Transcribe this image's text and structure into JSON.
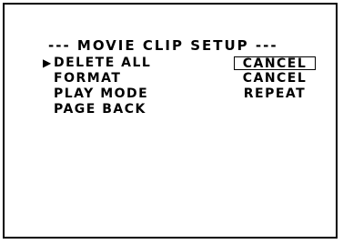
{
  "title": "--- MOVIE CLIP SETUP ---",
  "cursor": "▶",
  "menu": {
    "items": [
      {
        "label": "DELETE ALL",
        "value": "CANCEL"
      },
      {
        "label": "FORMAT",
        "value": "CANCEL"
      },
      {
        "label": "PLAY MODE",
        "value": "REPEAT"
      },
      {
        "label": "PAGE BACK"
      }
    ]
  }
}
